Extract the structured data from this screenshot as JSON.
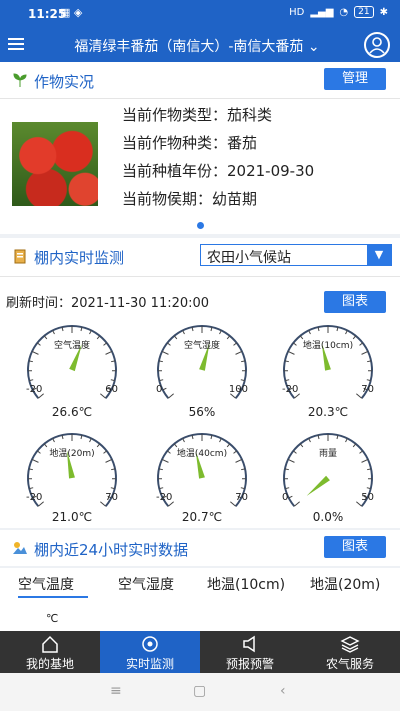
{
  "status": {
    "time": "11:25",
    "signal_text": "HD",
    "battery": "21"
  },
  "header": {
    "title": "福清绿丰番茄（南信大）-南信大番茄"
  },
  "crop": {
    "section_title": "作物实况",
    "manage_label": "管理",
    "lines": [
      "当前作物类型：茄科类",
      "当前作物种类：番茄",
      "当前种植年份：2021-09-30",
      "当前物侯期：幼苗期"
    ]
  },
  "monitor": {
    "section_title": "棚内实时监测",
    "station": "农田小气候站",
    "refresh": "刷新时间：2021-11-30 11:20:00",
    "chart_label": "图表",
    "gauges": [
      {
        "name": "空气温度",
        "min": "-20",
        "max": "60",
        "value": "26.6℃",
        "fraction": 0.58
      },
      {
        "name": "空气湿度",
        "min": "0",
        "max": "100",
        "value": "56%",
        "fraction": 0.56
      },
      {
        "name": "地温(10cm)",
        "min": "-20",
        "max": "70",
        "value": "20.3℃",
        "fraction": 0.45
      },
      {
        "name": "地温(20m)",
        "min": "-20",
        "max": "70",
        "value": "21.0℃",
        "fraction": 0.46
      },
      {
        "name": "地温(40cm)",
        "min": "-20",
        "max": "70",
        "value": "20.7℃",
        "fraction": 0.45
      },
      {
        "name": "雨量",
        "min": "0",
        "max": "50",
        "value": "0.0%",
        "fraction": 0.0
      }
    ]
  },
  "history": {
    "section_title": "棚内近24小时实时数据",
    "chart_label": "图表",
    "tabs": [
      "空气温度",
      "空气湿度",
      "地温(10cm)",
      "地温(20m)"
    ],
    "unit": "℃"
  },
  "nav": {
    "items": [
      {
        "label": "我的基地",
        "icon": "home-icon"
      },
      {
        "label": "实时监测",
        "icon": "target-icon"
      },
      {
        "label": "预报预警",
        "icon": "speaker-icon"
      },
      {
        "label": "农气服务",
        "icon": "layers-icon"
      }
    ]
  },
  "colors": {
    "primary": "#1f63c6",
    "accent": "#2b78e4",
    "gauge_needle": "#7dbb2e"
  }
}
